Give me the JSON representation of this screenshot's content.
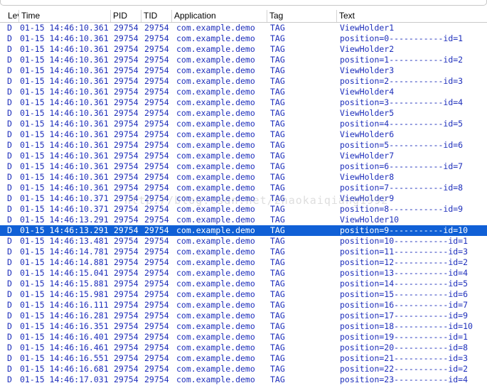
{
  "columns": [
    {
      "key": "level",
      "label": "Lev"
    },
    {
      "key": "time",
      "label": "Time"
    },
    {
      "key": "pid",
      "label": "PID"
    },
    {
      "key": "tid",
      "label": "TID"
    },
    {
      "key": "app",
      "label": "Application"
    },
    {
      "key": "tag",
      "label": "Tag"
    },
    {
      "key": "text",
      "label": "Text"
    }
  ],
  "colors": {
    "row_text": "#1e2fbb",
    "selected_bg": "#1060d6",
    "selected_text": "#ffffff"
  },
  "selected_index": 19,
  "watermark": "http://blog.csdn.net/zhaokaiqiang1992",
  "rows": [
    {
      "level": "D",
      "time": "01-15 14:46:10.361",
      "pid": "29754",
      "tid": "29754",
      "app": "com.example.demo",
      "tag": "TAG",
      "text": "ViewHolder1"
    },
    {
      "level": "D",
      "time": "01-15 14:46:10.361",
      "pid": "29754",
      "tid": "29754",
      "app": "com.example.demo",
      "tag": "TAG",
      "text": "position=0-----------id=1"
    },
    {
      "level": "D",
      "time": "01-15 14:46:10.361",
      "pid": "29754",
      "tid": "29754",
      "app": "com.example.demo",
      "tag": "TAG",
      "text": "ViewHolder2"
    },
    {
      "level": "D",
      "time": "01-15 14:46:10.361",
      "pid": "29754",
      "tid": "29754",
      "app": "com.example.demo",
      "tag": "TAG",
      "text": "position=1-----------id=2"
    },
    {
      "level": "D",
      "time": "01-15 14:46:10.361",
      "pid": "29754",
      "tid": "29754",
      "app": "com.example.demo",
      "tag": "TAG",
      "text": "ViewHolder3"
    },
    {
      "level": "D",
      "time": "01-15 14:46:10.361",
      "pid": "29754",
      "tid": "29754",
      "app": "com.example.demo",
      "tag": "TAG",
      "text": "position=2-----------id=3"
    },
    {
      "level": "D",
      "time": "01-15 14:46:10.361",
      "pid": "29754",
      "tid": "29754",
      "app": "com.example.demo",
      "tag": "TAG",
      "text": "ViewHolder4"
    },
    {
      "level": "D",
      "time": "01-15 14:46:10.361",
      "pid": "29754",
      "tid": "29754",
      "app": "com.example.demo",
      "tag": "TAG",
      "text": "position=3-----------id=4"
    },
    {
      "level": "D",
      "time": "01-15 14:46:10.361",
      "pid": "29754",
      "tid": "29754",
      "app": "com.example.demo",
      "tag": "TAG",
      "text": "ViewHolder5"
    },
    {
      "level": "D",
      "time": "01-15 14:46:10.361",
      "pid": "29754",
      "tid": "29754",
      "app": "com.example.demo",
      "tag": "TAG",
      "text": "position=4-----------id=5"
    },
    {
      "level": "D",
      "time": "01-15 14:46:10.361",
      "pid": "29754",
      "tid": "29754",
      "app": "com.example.demo",
      "tag": "TAG",
      "text": "ViewHolder6"
    },
    {
      "level": "D",
      "time": "01-15 14:46:10.361",
      "pid": "29754",
      "tid": "29754",
      "app": "com.example.demo",
      "tag": "TAG",
      "text": "position=5-----------id=6"
    },
    {
      "level": "D",
      "time": "01-15 14:46:10.361",
      "pid": "29754",
      "tid": "29754",
      "app": "com.example.demo",
      "tag": "TAG",
      "text": "ViewHolder7"
    },
    {
      "level": "D",
      "time": "01-15 14:46:10.361",
      "pid": "29754",
      "tid": "29754",
      "app": "com.example.demo",
      "tag": "TAG",
      "text": "position=6-----------id=7"
    },
    {
      "level": "D",
      "time": "01-15 14:46:10.361",
      "pid": "29754",
      "tid": "29754",
      "app": "com.example.demo",
      "tag": "TAG",
      "text": "ViewHolder8"
    },
    {
      "level": "D",
      "time": "01-15 14:46:10.361",
      "pid": "29754",
      "tid": "29754",
      "app": "com.example.demo",
      "tag": "TAG",
      "text": "position=7-----------id=8"
    },
    {
      "level": "D",
      "time": "01-15 14:46:10.371",
      "pid": "29754",
      "tid": "29754",
      "app": "com.example.demo",
      "tag": "TAG",
      "text": "ViewHolder9"
    },
    {
      "level": "D",
      "time": "01-15 14:46:10.371",
      "pid": "29754",
      "tid": "29754",
      "app": "com.example.demo",
      "tag": "TAG",
      "text": "position=8-----------id=9"
    },
    {
      "level": "D",
      "time": "01-15 14:46:13.291",
      "pid": "29754",
      "tid": "29754",
      "app": "com.example.demo",
      "tag": "TAG",
      "text": "ViewHolder10"
    },
    {
      "level": "D",
      "time": "01-15 14:46:13.291",
      "pid": "29754",
      "tid": "29754",
      "app": "com.example.demo",
      "tag": "TAG",
      "text": "position=9-----------id=10"
    },
    {
      "level": "D",
      "time": "01-15 14:46:13.481",
      "pid": "29754",
      "tid": "29754",
      "app": "com.example.demo",
      "tag": "TAG",
      "text": "position=10-----------id=1"
    },
    {
      "level": "D",
      "time": "01-15 14:46:14.781",
      "pid": "29754",
      "tid": "29754",
      "app": "com.example.demo",
      "tag": "TAG",
      "text": "position=11-----------id=3"
    },
    {
      "level": "D",
      "time": "01-15 14:46:14.881",
      "pid": "29754",
      "tid": "29754",
      "app": "com.example.demo",
      "tag": "TAG",
      "text": "position=12-----------id=2"
    },
    {
      "level": "D",
      "time": "01-15 14:46:15.041",
      "pid": "29754",
      "tid": "29754",
      "app": "com.example.demo",
      "tag": "TAG",
      "text": "position=13-----------id=4"
    },
    {
      "level": "D",
      "time": "01-15 14:46:15.881",
      "pid": "29754",
      "tid": "29754",
      "app": "com.example.demo",
      "tag": "TAG",
      "text": "position=14-----------id=5"
    },
    {
      "level": "D",
      "time": "01-15 14:46:15.981",
      "pid": "29754",
      "tid": "29754",
      "app": "com.example.demo",
      "tag": "TAG",
      "text": "position=15-----------id=6"
    },
    {
      "level": "D",
      "time": "01-15 14:46:16.111",
      "pid": "29754",
      "tid": "29754",
      "app": "com.example.demo",
      "tag": "TAG",
      "text": "position=16-----------id=7"
    },
    {
      "level": "D",
      "time": "01-15 14:46:16.281",
      "pid": "29754",
      "tid": "29754",
      "app": "com.example.demo",
      "tag": "TAG",
      "text": "position=17-----------id=9"
    },
    {
      "level": "D",
      "time": "01-15 14:46:16.351",
      "pid": "29754",
      "tid": "29754",
      "app": "com.example.demo",
      "tag": "TAG",
      "text": "position=18-----------id=10"
    },
    {
      "level": "D",
      "time": "01-15 14:46:16.401",
      "pid": "29754",
      "tid": "29754",
      "app": "com.example.demo",
      "tag": "TAG",
      "text": "position=19-----------id=1"
    },
    {
      "level": "D",
      "time": "01-15 14:46:16.461",
      "pid": "29754",
      "tid": "29754",
      "app": "com.example.demo",
      "tag": "TAG",
      "text": "position=20-----------id=8"
    },
    {
      "level": "D",
      "time": "01-15 14:46:16.551",
      "pid": "29754",
      "tid": "29754",
      "app": "com.example.demo",
      "tag": "TAG",
      "text": "position=21-----------id=3"
    },
    {
      "level": "D",
      "time": "01-15 14:46:16.681",
      "pid": "29754",
      "tid": "29754",
      "app": "com.example.demo",
      "tag": "TAG",
      "text": "position=22-----------id=2"
    },
    {
      "level": "D",
      "time": "01-15 14:46:17.031",
      "pid": "29754",
      "tid": "29754",
      "app": "com.example.demo",
      "tag": "TAG",
      "text": "position=23-----------id=4"
    }
  ]
}
